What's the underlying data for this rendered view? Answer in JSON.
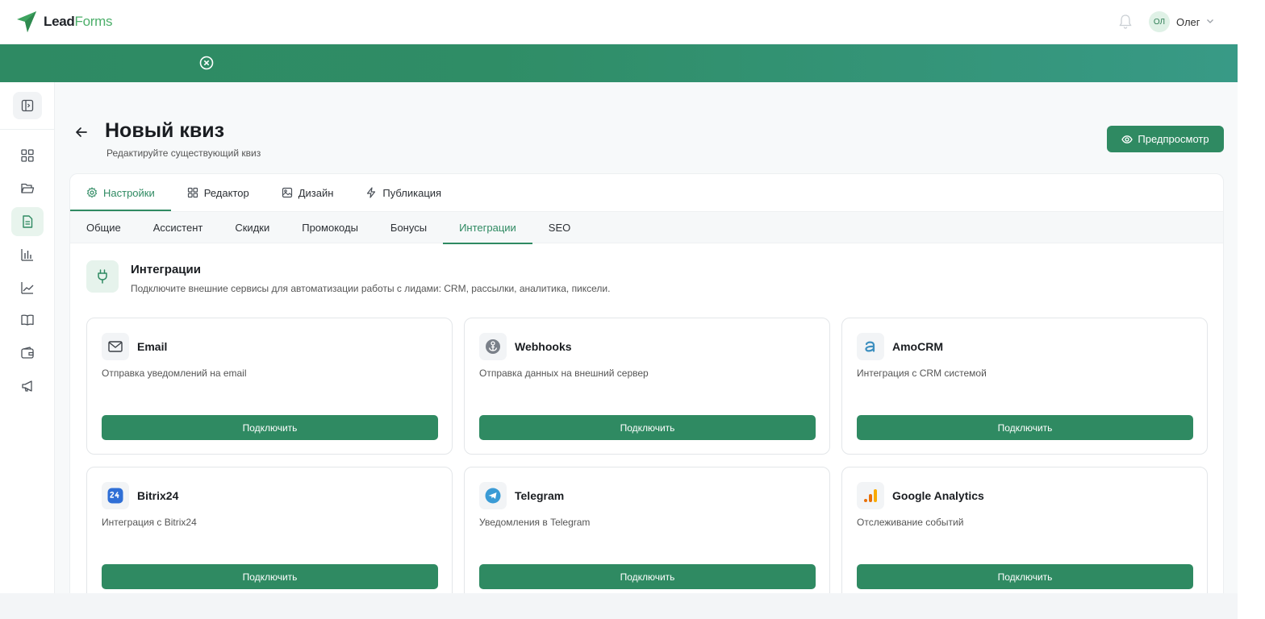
{
  "header": {
    "logo_lead": "Lead",
    "logo_forms": "Forms",
    "user_initials": "ОЛ",
    "user_name": "Олег"
  },
  "page": {
    "title": "Новый квиз",
    "subtitle": "Редактируйте существующий квиз",
    "preview_label": "Предпросмотр"
  },
  "tabs": [
    {
      "label": "Настройки",
      "icon": "gear-icon",
      "active": true
    },
    {
      "label": "Редактор",
      "icon": "grid-icon",
      "active": false
    },
    {
      "label": "Дизайн",
      "icon": "image-icon",
      "active": false
    },
    {
      "label": "Публикация",
      "icon": "lightning-icon",
      "active": false
    }
  ],
  "subtabs": [
    {
      "label": "Общие",
      "active": false
    },
    {
      "label": "Ассистент",
      "active": false
    },
    {
      "label": "Скидки",
      "active": false
    },
    {
      "label": "Промокоды",
      "active": false
    },
    {
      "label": "Бонусы",
      "active": false
    },
    {
      "label": "Интеграции",
      "active": true
    },
    {
      "label": "SEO",
      "active": false
    }
  ],
  "section": {
    "title": "Интеграции",
    "description": "Подключите внешние сервисы для автоматизации работы с лидами: CRM, рассылки, аналитика, пиксели."
  },
  "cards": [
    {
      "title": "Email",
      "description": "Отправка уведомлений на email",
      "button": "Подключить",
      "icon": "mail-icon"
    },
    {
      "title": "Webhooks",
      "description": "Отправка данных на внешний сервер",
      "button": "Подключить",
      "icon": "webhook-icon"
    },
    {
      "title": "AmoCRM",
      "description": "Интеграция с CRM системой",
      "button": "Подключить",
      "icon": "amocrm-icon"
    },
    {
      "title": "Bitrix24",
      "description": "Интеграция с Bitrix24",
      "button": "Подключить",
      "icon": "bitrix24-icon"
    },
    {
      "title": "Telegram",
      "description": "Уведомления в Telegram",
      "button": "Подключить",
      "icon": "telegram-icon"
    },
    {
      "title": "Google Analytics",
      "description": "Отслеживание событий",
      "button": "Подключить",
      "icon": "google-analytics-icon"
    }
  ],
  "colors": {
    "accent": "#2f8a62",
    "banner": "#2e8a63",
    "logo_green": "#4caf6a"
  }
}
